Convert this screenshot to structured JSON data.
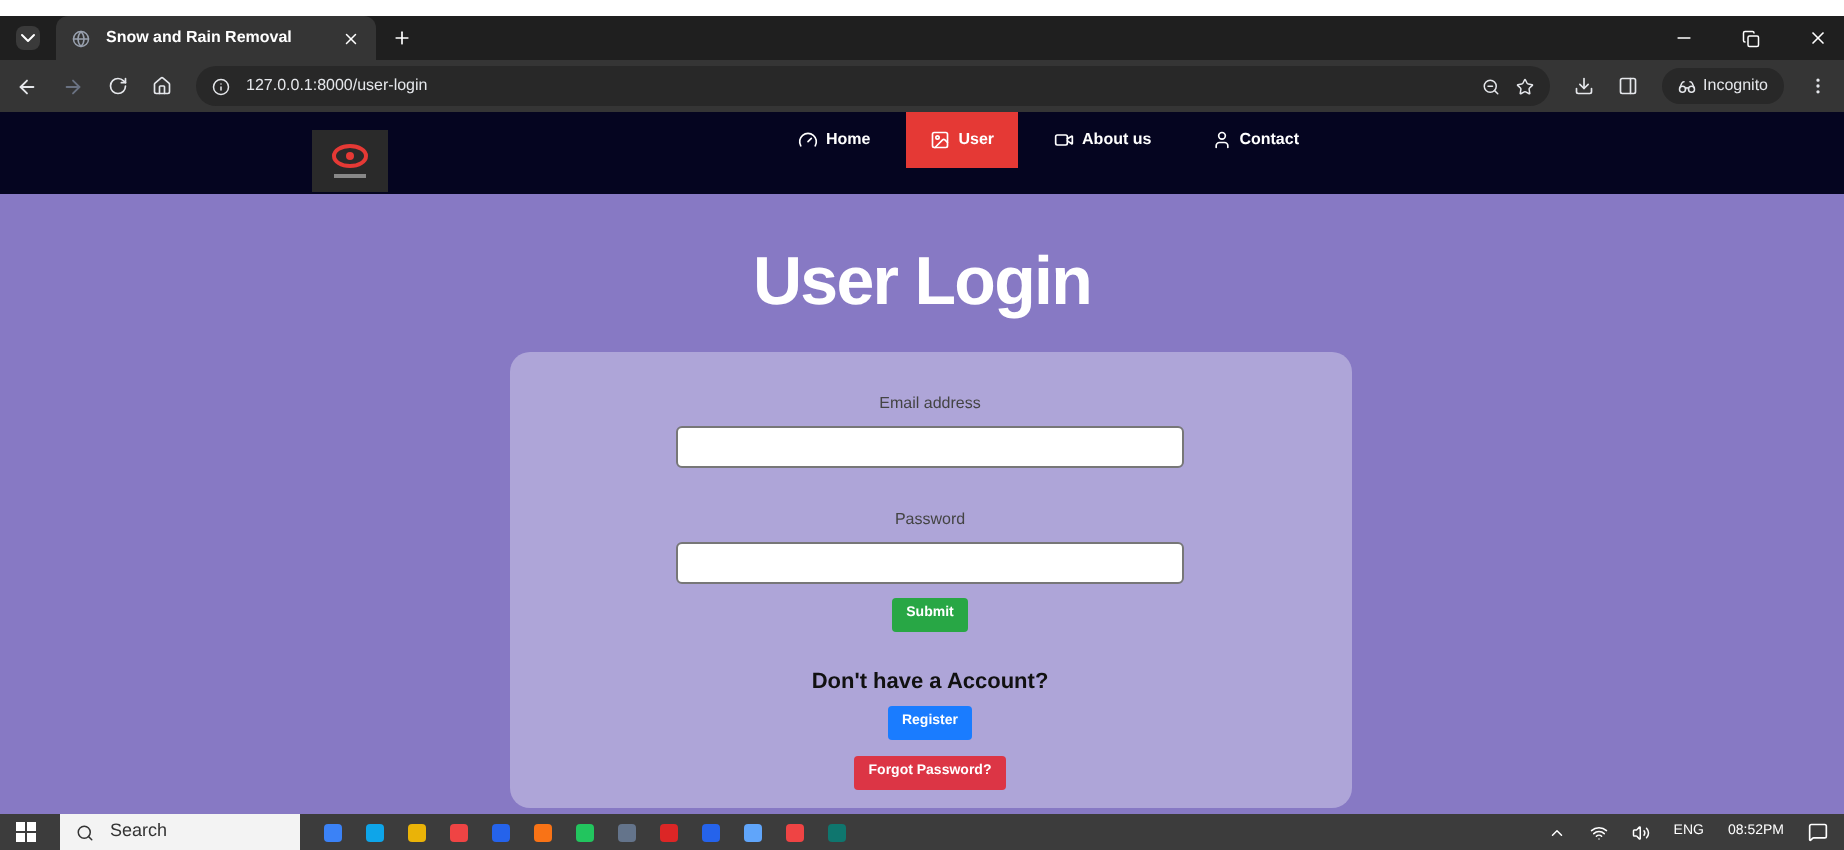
{
  "browser": {
    "tab_title": "Snow and Rain Removal",
    "url": "127.0.0.1:8000/user-login",
    "incognito_label": "Incognito"
  },
  "nav": {
    "items": [
      {
        "label": "Home",
        "kind": "home",
        "selected": false
      },
      {
        "label": "User",
        "kind": "user",
        "selected": true
      },
      {
        "label": "About us",
        "kind": "about",
        "selected": false
      },
      {
        "label": "Contact",
        "kind": "contact",
        "selected": false
      }
    ]
  },
  "heading": "User Login",
  "form": {
    "email_label": "Email address",
    "password_label": "Password",
    "submit": "Submit",
    "prompt": "Don't have a Account?",
    "register": "Register",
    "forgot": "Forgot Password?"
  },
  "taskbar": {
    "search_placeholder": "Search",
    "language": "ENG",
    "time": "08:52PM"
  }
}
